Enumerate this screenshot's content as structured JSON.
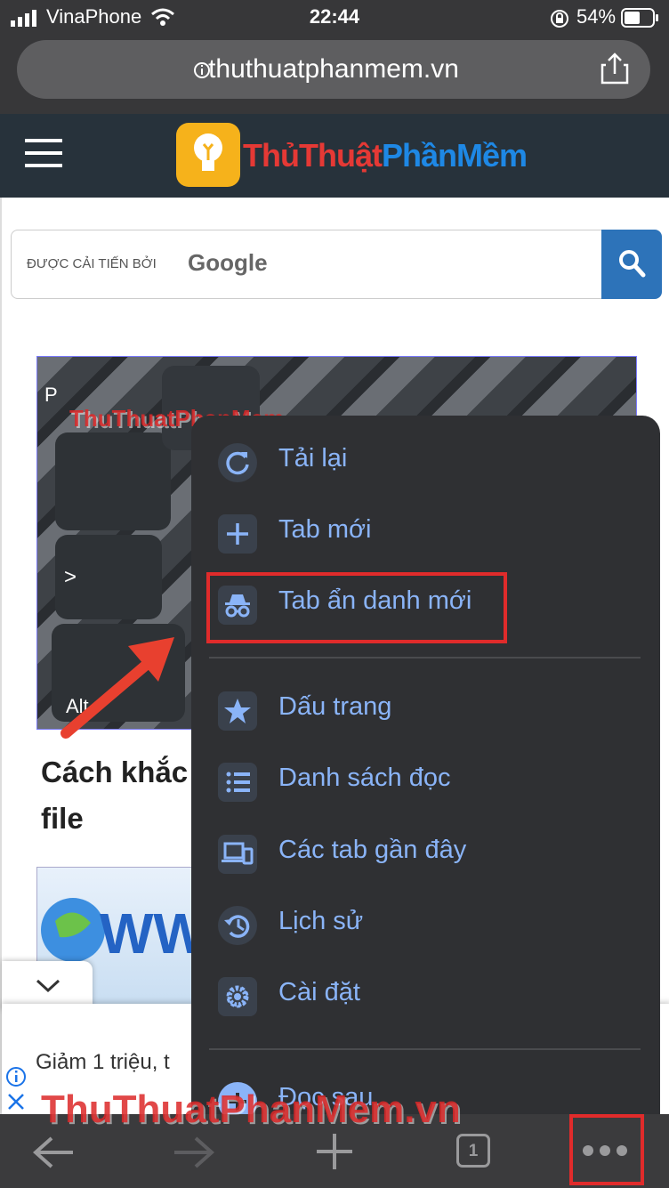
{
  "status_bar": {
    "carrier": "VinaPhone",
    "time": "22:44",
    "battery": "54%"
  },
  "address_bar": {
    "url": "thuthuatphanmem.vn"
  },
  "site": {
    "logo_part1": "ThủThuật",
    "logo_part2": "PhầnMềm",
    "search": {
      "powered_by": "ĐƯỢC CẢI TIẾN BỞI",
      "brand": "Google"
    },
    "article_title": "Cách khắc file",
    "ad_text": "Giảm 1 triệu, t"
  },
  "menu": {
    "items": [
      {
        "label": "Tải lại",
        "icon": "reload-icon"
      },
      {
        "label": "Tab mới",
        "icon": "plus-icon"
      },
      {
        "label": "Tab ẩn danh mới",
        "icon": "incognito-icon"
      },
      {
        "label": "Dấu trang",
        "icon": "star-icon"
      },
      {
        "label": "Danh sách đọc",
        "icon": "list-icon"
      },
      {
        "label": "Các tab gần đây",
        "icon": "devices-icon"
      },
      {
        "label": "Lịch sử",
        "icon": "history-icon"
      },
      {
        "label": "Cài đặt",
        "icon": "gear-icon"
      },
      {
        "label": "Đọc sau",
        "icon": "read-later-icon"
      }
    ]
  },
  "toolbar": {
    "tab_count": "1"
  },
  "watermark": {
    "text_main": "ThuThuatPhanMem",
    "text_suffix": ".vn",
    "text_small": "ThuThuatPhanMem"
  },
  "colors": {
    "accent": "#8ab4f8",
    "highlight": "#e02b2b",
    "menu_bg": "#2f3033"
  }
}
